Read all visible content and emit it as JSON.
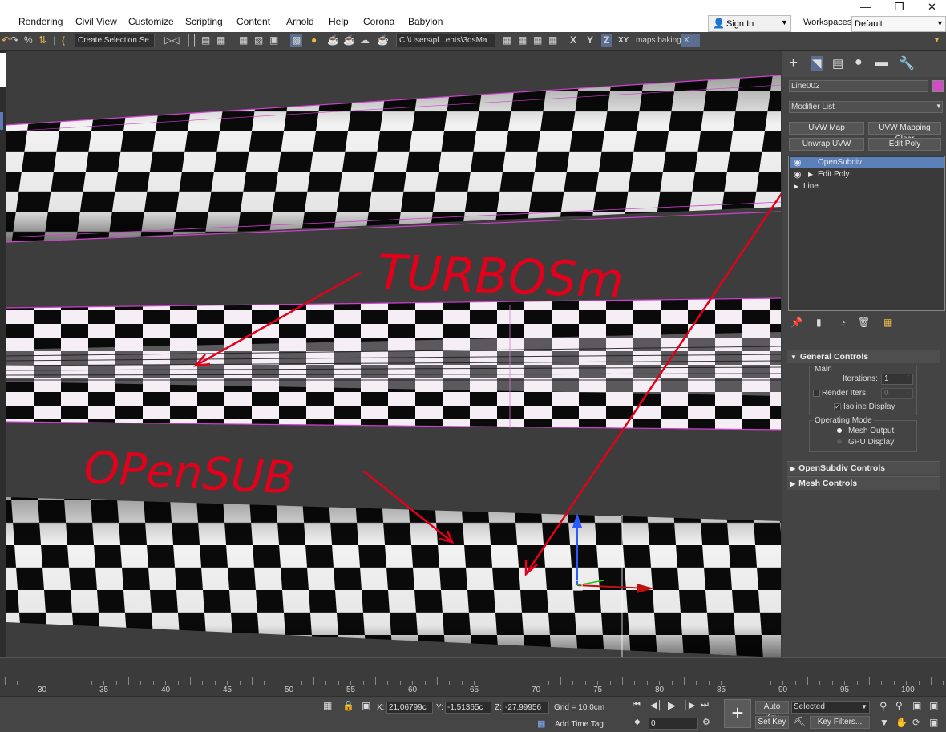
{
  "menubar": {
    "items": [
      "Rendering",
      "Civil View",
      "Customize",
      "Scripting",
      "Content",
      "Arnold",
      "Help",
      "Corona",
      "Babylon"
    ],
    "sign_in": "Sign In",
    "workspaces_label": "Workspaces:",
    "workspace_value": "Default"
  },
  "toolbar": {
    "selection_set": "Create Selection Se",
    "path": "C:\\Users\\pl...ents\\3dsMa",
    "axis_x": "X",
    "axis_y": "Y",
    "axis_z": "Z",
    "axis_xy": "XY",
    "maps_baking": "maps baking"
  },
  "viewport": {
    "annotation_turbo": "TURBOSm",
    "annotation_opensub": "OPenSUB",
    "colors": {
      "background": "#3d3d3d",
      "annotation": "#e3001b",
      "wire": "#d040d0"
    }
  },
  "command_panel": {
    "object_name": "Line002",
    "object_color": "#d54bc7",
    "modifier_list": "Modifier List",
    "buttons": [
      "UVW Map",
      "UVW Mapping Clear",
      "Unwrap UVW",
      "Edit Poly"
    ],
    "stack": [
      "OpenSubdiv",
      "Edit Poly",
      "Line"
    ],
    "general_controls": {
      "title": "General Controls",
      "main_label": "Main",
      "iterations_label": "Iterations:",
      "iterations_value": "1",
      "render_iters_label": "Render Iters:",
      "render_iters_value": "0",
      "isoline_label": "Isoline Display",
      "operating_mode_label": "Operating Mode",
      "mesh_output": "Mesh Output",
      "gpu_display": "GPU Display"
    },
    "rollouts": [
      "OpenSubdiv Controls",
      "Mesh Controls"
    ]
  },
  "timeline": {
    "ticks": [
      "30",
      "35",
      "40",
      "45",
      "50",
      "55",
      "60",
      "65",
      "70",
      "75",
      "80",
      "85",
      "90",
      "95",
      "100"
    ]
  },
  "statusbar": {
    "x_label": "X:",
    "x_value": "21,06799c",
    "y_label": "Y:",
    "y_value": "-1,51365c",
    "z_label": "Z:",
    "z_value": "-27,99956",
    "grid": "Grid = 10,0cm",
    "add_time_tag": "Add Time Tag",
    "auto_key": "Auto Key",
    "selected": "Selected",
    "set_key": "Set Key",
    "key_filters": "Key Filters...",
    "frame_value": "0"
  }
}
